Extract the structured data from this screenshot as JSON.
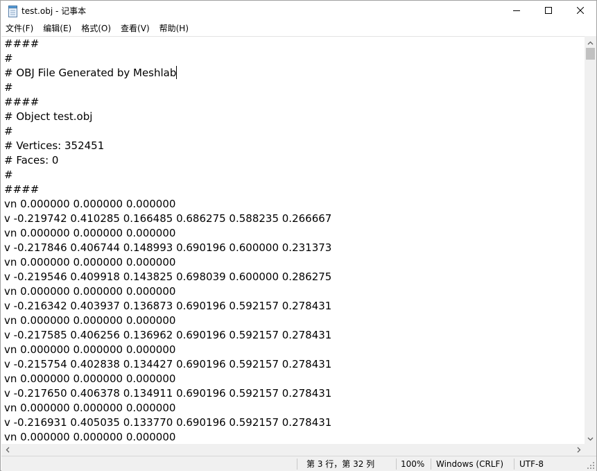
{
  "window": {
    "title": "test.obj - 记事本",
    "icon": "notepad-icon",
    "controls": {
      "minimize": "minimize-icon",
      "maximize": "maximize-icon",
      "close": "close-icon"
    }
  },
  "menu": {
    "items": [
      {
        "label": "文件(F)"
      },
      {
        "label": "编辑(E)"
      },
      {
        "label": "格式(O)"
      },
      {
        "label": "查看(V)"
      },
      {
        "label": "帮助(H)"
      }
    ]
  },
  "editor": {
    "lines": [
      "####",
      "#",
      "# OBJ File Generated by Meshlab",
      "#",
      "####",
      "# Object test.obj",
      "#",
      "# Vertices: 352451",
      "# Faces: 0",
      "#",
      "####",
      "vn 0.000000 0.000000 0.000000",
      "v -0.219742 0.410285 0.166485 0.686275 0.588235 0.266667",
      "vn 0.000000 0.000000 0.000000",
      "v -0.217846 0.406744 0.148993 0.690196 0.600000 0.231373",
      "vn 0.000000 0.000000 0.000000",
      "v -0.219546 0.409918 0.143825 0.698039 0.600000 0.286275",
      "vn 0.000000 0.000000 0.000000",
      "v -0.216342 0.403937 0.136873 0.690196 0.592157 0.278431",
      "vn 0.000000 0.000000 0.000000",
      "v -0.217585 0.406256 0.136962 0.690196 0.592157 0.278431",
      "vn 0.000000 0.000000 0.000000",
      "v -0.215754 0.402838 0.134427 0.690196 0.592157 0.278431",
      "vn 0.000000 0.000000 0.000000",
      "v -0.217650 0.406378 0.134911 0.690196 0.592157 0.278431",
      "vn 0.000000 0.000000 0.000000",
      "v -0.216931 0.405035 0.133770 0.690196 0.592157 0.278431",
      "vn 0.000000 0.000000 0.000000"
    ],
    "caret_line": 3
  },
  "status": {
    "position": "第 3 行，第 32 列",
    "zoom": "100%",
    "line_ending": "Windows (CRLF)",
    "encoding": "UTF-8"
  }
}
